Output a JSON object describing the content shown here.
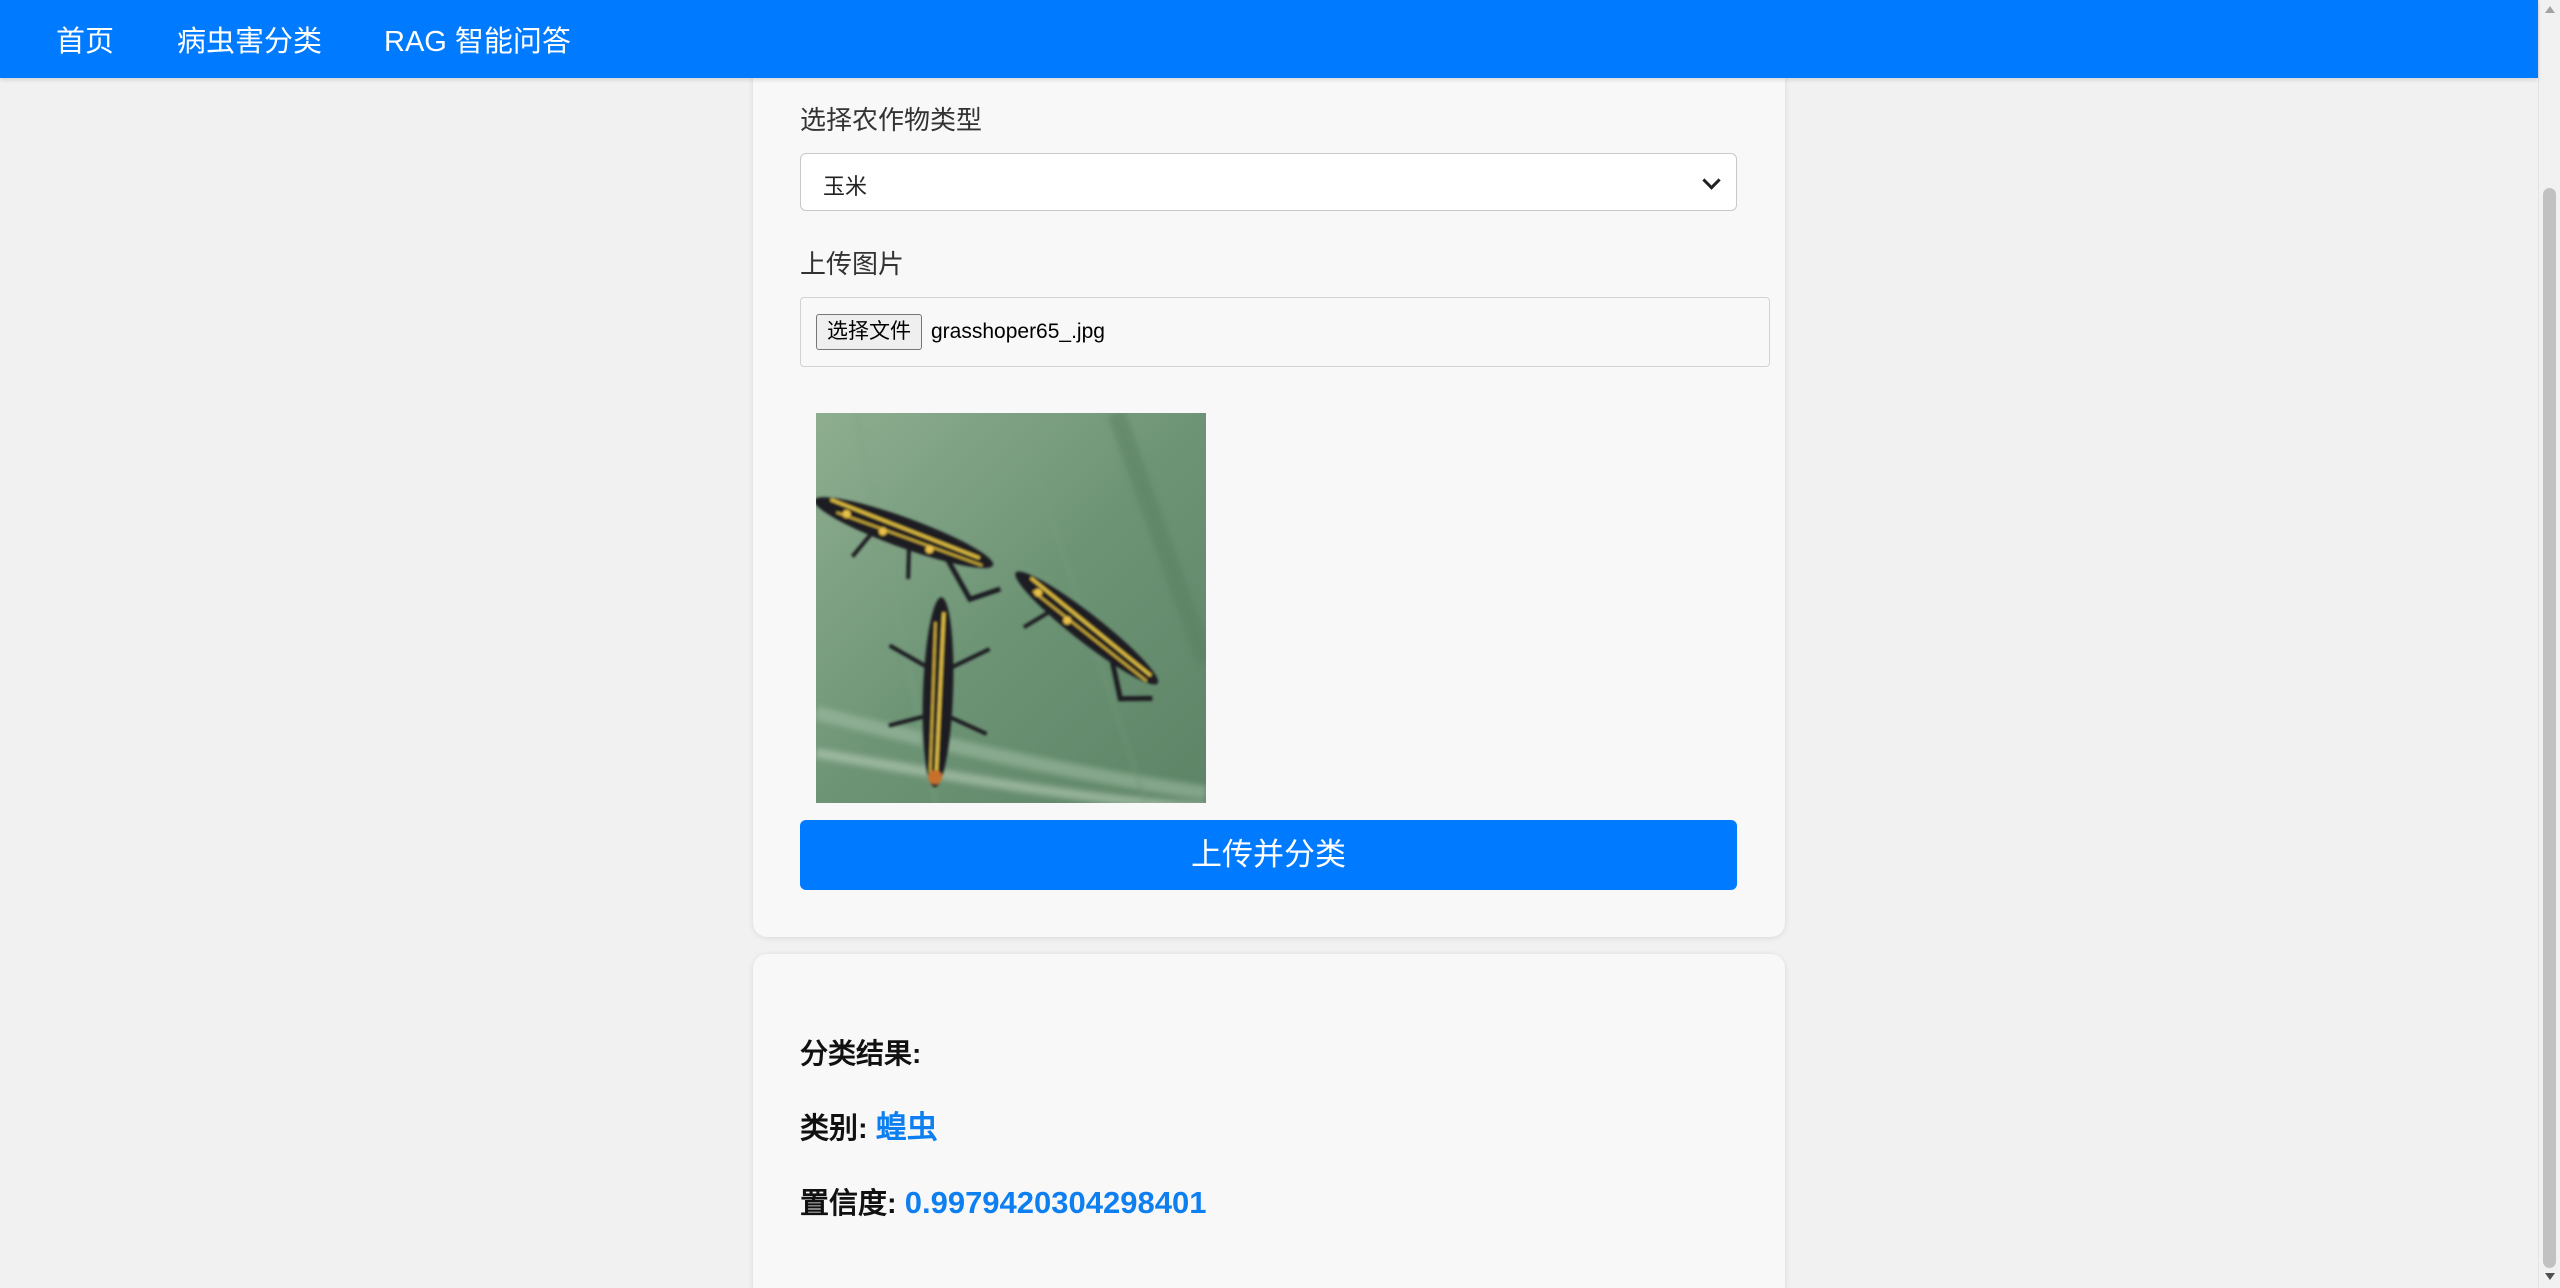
{
  "nav": {
    "items": [
      {
        "label": "首页"
      },
      {
        "label": "病虫害分类"
      },
      {
        "label": "RAG 智能问答"
      }
    ]
  },
  "upload_form": {
    "crop_label": "选择农作物类型",
    "crop_selected": "玉米",
    "upload_label": "上传图片",
    "file_button_label": "选择文件",
    "file_name": "grasshoper65_.jpg",
    "submit_label": "上传并分类"
  },
  "result": {
    "heading": "分类结果:",
    "class_label": "类别:",
    "class_value": "蝗虫",
    "confidence_label": "置信度:",
    "confidence_value": "0.9979420304298401"
  },
  "colors": {
    "accent": "#007bff",
    "result_value": "#0d7ff0",
    "page_bg": "#f1f1f1",
    "card_bg": "#f8f8f8"
  }
}
